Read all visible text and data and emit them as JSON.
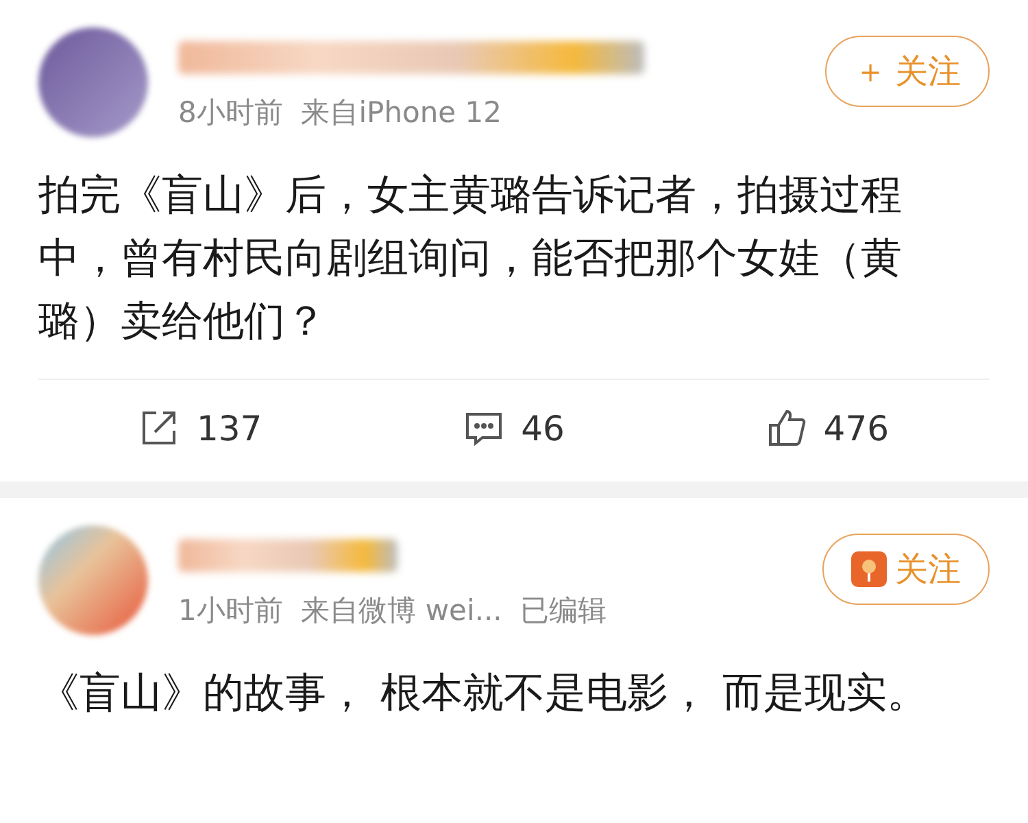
{
  "posts": [
    {
      "meta": "8小时前  来自iPhone 12",
      "follow": {
        "plus": "＋",
        "label": "关注",
        "kind": "plus"
      },
      "body": "拍完《盲山》后，女主黄璐告诉记者，拍摄过程中，曾有村民向剧组询问，能否把那个女娃（黄璐）卖给他们？",
      "actions": [
        {
          "kind": "share",
          "count": "137"
        },
        {
          "kind": "comment",
          "count": "46"
        },
        {
          "kind": "like",
          "count": "476"
        }
      ]
    },
    {
      "meta": "1小时前  来自微博 wei...  已编辑",
      "follow": {
        "label": "关注",
        "kind": "icon"
      },
      "body": "《盲山》的故事， 根本就不是电影， 而是现实。"
    }
  ]
}
